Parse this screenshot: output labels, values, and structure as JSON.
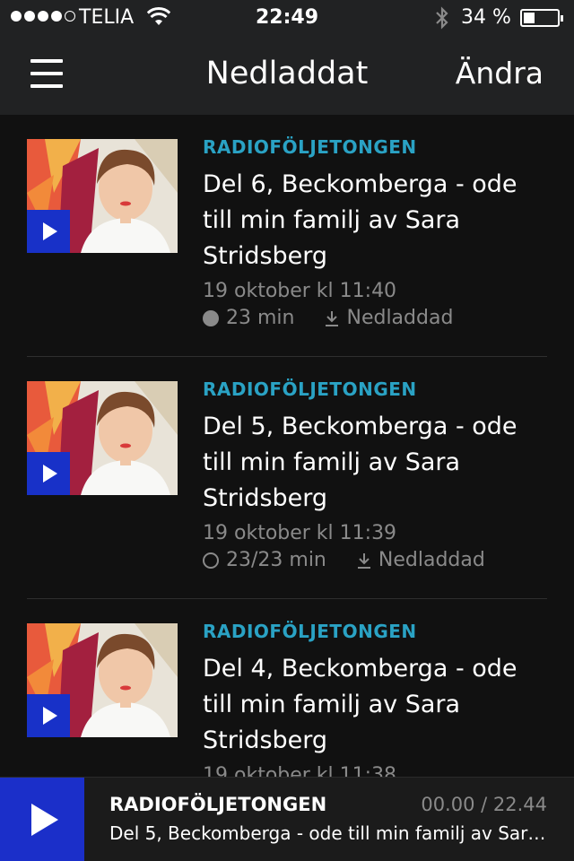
{
  "status_bar": {
    "carrier": "TELIA",
    "time": "22:49",
    "battery": "34 %",
    "battery_level": 0.34,
    "signal_bars": 4
  },
  "nav": {
    "title": "Nedladdat",
    "edit_label": "Ändra"
  },
  "colors": {
    "accent": "#2aa2c4",
    "play_blue": "#1b2fc9",
    "background": "#111111"
  },
  "episodes": [
    {
      "program": "RADIOFÖLJETONGEN",
      "title": "Del 6, Beckomberga - ode till min familj av Sara Stridsberg",
      "date": "19 oktober kl 11:40",
      "duration": "23 min",
      "progress_icon": "filled-circle-icon",
      "download_status": "Nedladdad"
    },
    {
      "program": "RADIOFÖLJETONGEN",
      "title": "Del 5, Beckomberga - ode till min familj av Sara Stridsberg",
      "date": "19 oktober kl 11:39",
      "duration": "23/23 min",
      "progress_icon": "ring-circle-icon",
      "download_status": "Nedladdad"
    },
    {
      "program": "RADIOFÖLJETONGEN",
      "title": "Del 4, Beckomberga - ode till min familj av Sara Stridsberg",
      "date": "19 oktober kl 11:38",
      "duration": "",
      "progress_icon": "",
      "download_status": ""
    }
  ],
  "player": {
    "program": "RADIOFÖLJETONGEN",
    "title": "Del 5, Beckomberga - ode till min familj av Sar…",
    "time": "00.00 / 22.44"
  }
}
